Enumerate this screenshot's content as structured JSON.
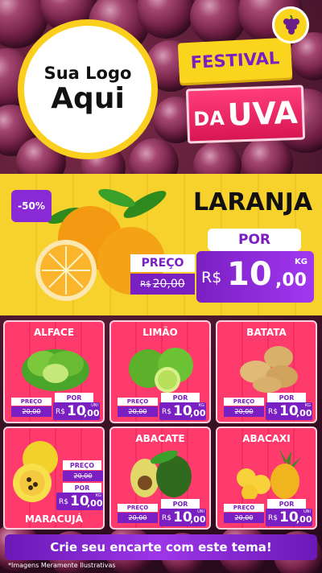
{
  "header": {
    "logo_line1": "Sua Logo",
    "logo_line2": "Aqui",
    "festival_top": "FESTIVAL",
    "festival_da": "DA",
    "festival_uva": "UVA"
  },
  "feature": {
    "discount": "-50%",
    "title": "LARANJA",
    "por_label": "POR",
    "preco_label": "PREÇO",
    "old_currency": "R$",
    "old_price": "20,00",
    "currency": "R$",
    "price_int": "10",
    "price_dec": ",00",
    "unit": "KG"
  },
  "products": [
    {
      "name": "ALFACE",
      "preco_label": "PREÇO",
      "old_price": "20,00",
      "por_label": "POR",
      "currency": "R$",
      "price_int": "10",
      "price_dec": ",00",
      "unit": "UNI"
    },
    {
      "name": "LIMÃO",
      "preco_label": "PREÇO",
      "old_price": "20,00",
      "por_label": "POR",
      "currency": "R$",
      "price_int": "10",
      "price_dec": ",00",
      "unit": "KG"
    },
    {
      "name": "BATATA",
      "preco_label": "PREÇO",
      "old_price": "20,00",
      "por_label": "POR",
      "currency": "R$",
      "price_int": "10",
      "price_dec": ",00",
      "unit": "KG"
    },
    {
      "name": "MARACUJÁ",
      "preco_label": "PREÇO",
      "old_price": "20,00",
      "por_label": "POR",
      "currency": "R$",
      "price_int": "10",
      "price_dec": ",00",
      "unit": "KG"
    },
    {
      "name": "ABACATE",
      "preco_label": "PREÇO",
      "old_price": "20,00",
      "por_label": "POR",
      "currency": "R$",
      "price_int": "10",
      "price_dec": ",00",
      "unit": "UNI"
    },
    {
      "name": "ABACAXI",
      "preco_label": "PREÇO",
      "old_price": "20,00",
      "por_label": "POR",
      "currency": "R$",
      "price_int": "10",
      "price_dec": ",00",
      "unit": "UNI"
    }
  ],
  "footer": {
    "cta": "Crie seu encarte com este tema!",
    "disclaimer": "*Imagens Meramente Ilustrativas"
  },
  "colors": {
    "purple": "#7a1fc2",
    "yellow": "#f7d22d",
    "pink": "#ff3a6c"
  }
}
